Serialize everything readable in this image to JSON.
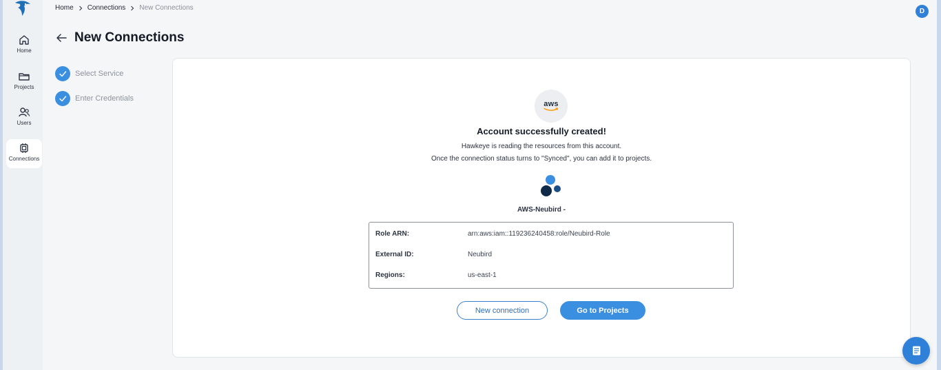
{
  "sidebar": {
    "items": [
      {
        "label": "Home",
        "icon": "home-icon"
      },
      {
        "label": "Projects",
        "icon": "folder-icon"
      },
      {
        "label": "Users",
        "icon": "users-icon"
      },
      {
        "label": "Connections",
        "icon": "chip-icon",
        "active": true
      }
    ]
  },
  "breadcrumb": {
    "items": [
      "Home",
      "Connections",
      "New Connections"
    ]
  },
  "user": {
    "avatar_initial": "D"
  },
  "page": {
    "title": "New Connections"
  },
  "steps": [
    {
      "label": "Select Service",
      "completed": true
    },
    {
      "label": "Enter Credentials",
      "completed": true
    }
  ],
  "result": {
    "provider_logo_text": "aws",
    "title": "Account successfully created!",
    "description_line1": "Hawkeye is reading the resources from this account.",
    "description_line2": "Once the connection status turns to \"Synced\", you can add it to projects.",
    "connection_name": "AWS-Neubird -",
    "details": [
      {
        "key": "Role ARN:",
        "value": "arn:aws:iam::119236240458:role/Neubird-Role"
      },
      {
        "key": "External ID:",
        "value": "Neubird"
      },
      {
        "key": "Regions:",
        "value": "us-east-1"
      }
    ],
    "new_connection_label": "New connection",
    "go_to_projects_label": "Go to Projects"
  },
  "colors": {
    "primary": "#3b8fe0",
    "aws_orange": "#ff9900",
    "dark_navy": "#0f2a47"
  }
}
